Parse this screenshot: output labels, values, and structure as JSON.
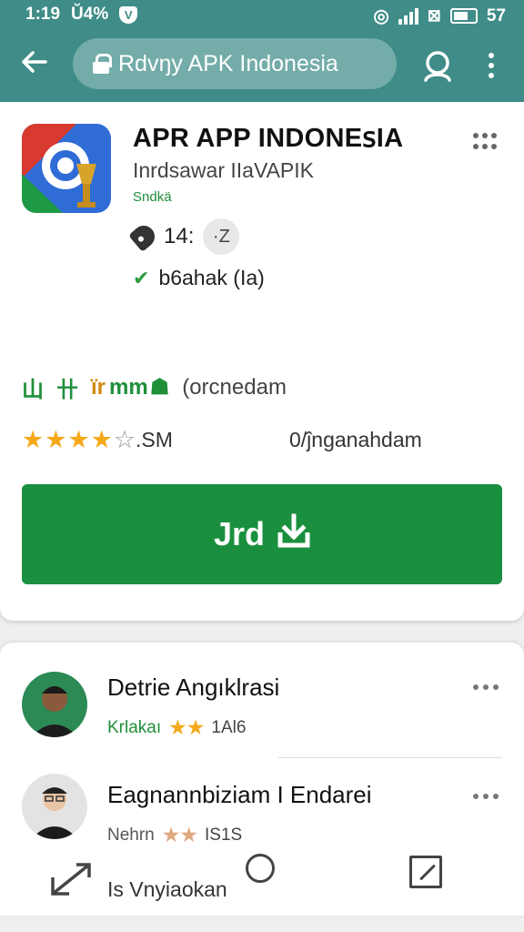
{
  "status_bar": {
    "time": "1:19",
    "battery_text": "Ŭ4%",
    "battery_level": "57"
  },
  "toolbar": {
    "url_text": "Rdvŋy APK Indonesia"
  },
  "app": {
    "title": "APR APP INDONEꜱIA",
    "developer": "Inrdsawar IIaVAPIK",
    "category": "Sndkä",
    "tag_text": "14:",
    "chip_text": "·Z",
    "verified_text": "b6ahak (Ia)"
  },
  "badges": {
    "glyph_1": "山",
    "glyph_2": "卄",
    "glyph_3": "ïr",
    "glyph_4": "mm",
    "text": "(orcnedam"
  },
  "rating": {
    "value_text": ".SM",
    "stars_filled": 4,
    "stars_total": 5,
    "downloads_text": "0/ĵnganahdam"
  },
  "install_button": {
    "label": "Jrd"
  },
  "reviews": [
    {
      "name": "Detrie Angıklrasi",
      "user": "Krlakaı",
      "stars": 2,
      "count": "1Al6"
    },
    {
      "name": "Eagnannbiziam I Endarei",
      "user": "Nehrn",
      "stars": 2,
      "count": "IS1S"
    }
  ],
  "bottom_bar": {
    "share_label": "Is Vnyiaokan"
  },
  "colors": {
    "toolbar": "#3f8c88",
    "install": "#1a8f3e",
    "star": "#f4a81a",
    "accent_text": "#1f8f3a"
  }
}
